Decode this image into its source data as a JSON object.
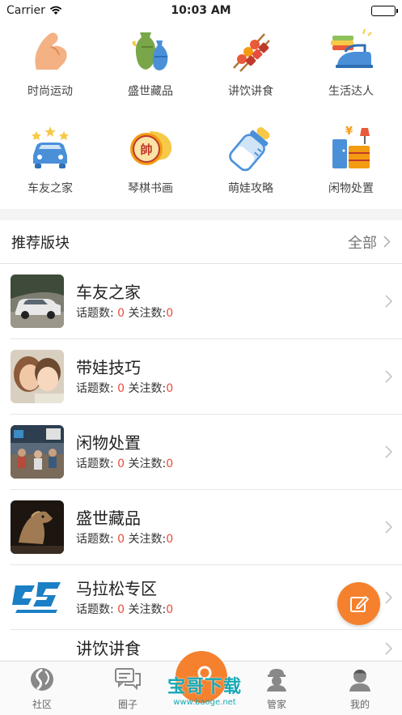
{
  "status": {
    "carrier": "Carrier",
    "time": "10:03 AM"
  },
  "categories": [
    {
      "label": "时尚运动",
      "icon": "arm-muscle-icon"
    },
    {
      "label": "盛世藏品",
      "icon": "vase-icon"
    },
    {
      "label": "讲饮讲食",
      "icon": "skewers-icon"
    },
    {
      "label": "生活达人",
      "icon": "iron-icon"
    },
    {
      "label": "车友之家",
      "icon": "car-icon"
    },
    {
      "label": "琴棋书画",
      "icon": "chess-icon"
    },
    {
      "label": "萌娃攻略",
      "icon": "baby-bottle-icon"
    },
    {
      "label": "闲物处置",
      "icon": "furniture-icon"
    }
  ],
  "recommend": {
    "title": "推荐版块",
    "all_label": "全部"
  },
  "boards": [
    {
      "name": "车友之家",
      "topics_label": "话题数:",
      "topics": "0",
      "follows_label": "关注数:",
      "follows": "0"
    },
    {
      "name": "带娃技巧",
      "topics_label": "话题数:",
      "topics": "0",
      "follows_label": "关注数:",
      "follows": "0"
    },
    {
      "name": "闲物处置",
      "topics_label": "话题数:",
      "topics": "0",
      "follows_label": "关注数:",
      "follows": "0"
    },
    {
      "name": "盛世藏品",
      "topics_label": "话题数:",
      "topics": "0",
      "follows_label": "关注数:",
      "follows": "0"
    },
    {
      "name": "马拉松专区",
      "topics_label": "话题数:",
      "topics": "0",
      "follows_label": "关注数:",
      "follows": "0"
    },
    {
      "name": "讲饮讲食",
      "topics_label": "",
      "topics": "",
      "follows_label": "",
      "follows": ""
    }
  ],
  "tabs": [
    {
      "label": "社区"
    },
    {
      "label": "圈子"
    },
    {
      "label": "管家"
    },
    {
      "label": "我的"
    }
  ],
  "watermark": {
    "text": "宝哥下载",
    "url": "www.baoge.net"
  },
  "colors": {
    "accent": "#f5812e",
    "count": "#e64d3c",
    "watermark": "#17a8b5"
  }
}
